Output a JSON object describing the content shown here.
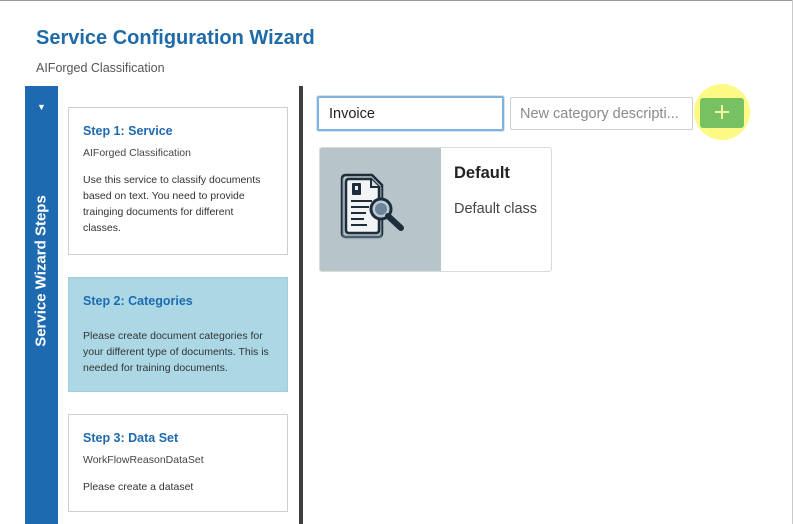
{
  "wizard": {
    "title": "Service Configuration Wizard",
    "subtitle": "AIForged Classification"
  },
  "sidebar": {
    "label": "Service Wizard Steps",
    "collapse_icon": "caret-down-icon",
    "steps": [
      {
        "title": "Step 1: Service",
        "subtitle": "AIForged Classification",
        "description": "Use this service to classify documents based on text. You need to provide trainging documents for different classes.",
        "active": false
      },
      {
        "title": "Step 2: Categories",
        "subtitle": "",
        "description": "Please create document categories for your different type of documents. This is needed for training documents.",
        "active": true
      },
      {
        "title": "Step 3: Data Set",
        "subtitle": "WorkFlowReasonDataSet",
        "description": "Please create a dataset",
        "active": false
      }
    ]
  },
  "category_form": {
    "name_value": "Invoice",
    "description_value": "",
    "description_placeholder": "New category descripti...",
    "add_icon": "plus-icon"
  },
  "categories": [
    {
      "name": "Default",
      "description": "Default class",
      "icon": "document-search-icon"
    }
  ],
  "colors": {
    "accent": "#1e6ab0",
    "active_step_bg": "#acd8e6",
    "add_button": "#77c163",
    "highlight": "#fbf86e"
  }
}
